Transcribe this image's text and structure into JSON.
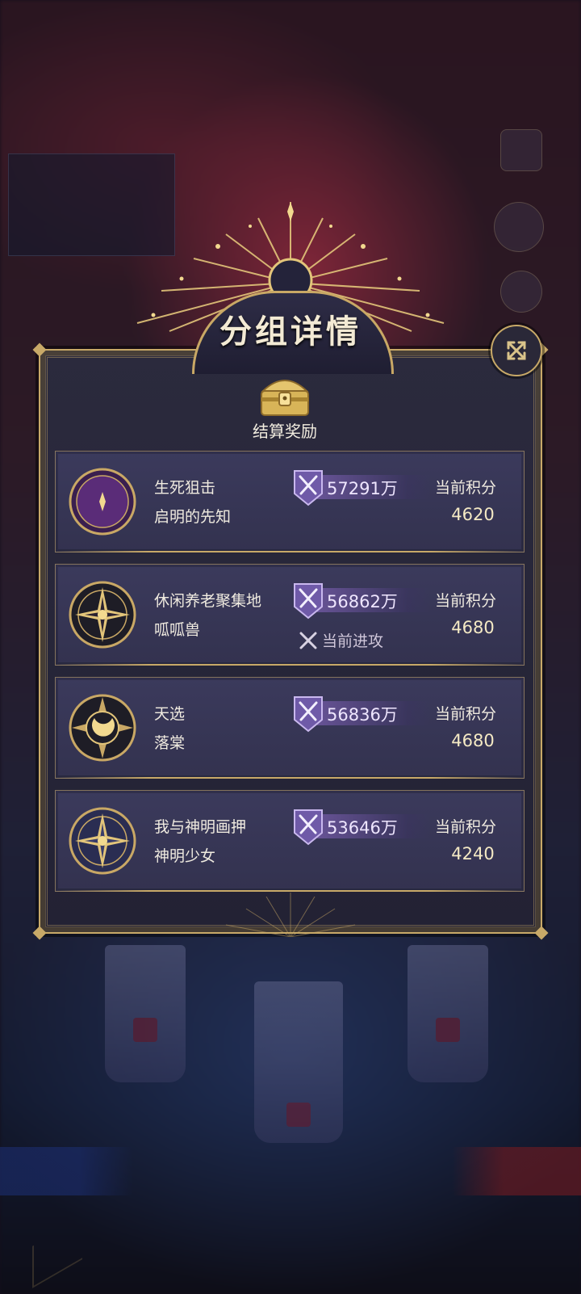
{
  "modal": {
    "title": "分组详情",
    "reward_label": "结算奖励"
  },
  "rows": [
    {
      "guild": "生死狙击",
      "leader": "启明的先知",
      "power": "57291万",
      "score_label": "当前积分",
      "score": "4620",
      "emblem": "crescent-moon-emblem",
      "status": ""
    },
    {
      "guild": "休闲养老聚集地",
      "leader": "呱呱兽",
      "power": "56862万",
      "score_label": "当前积分",
      "score": "4680",
      "emblem": "compass-star-emblem",
      "status": "当前进攻"
    },
    {
      "guild": "天选",
      "leader": "落棠",
      "power": "56836万",
      "score_label": "当前积分",
      "score": "4680",
      "emblem": "sun-moon-emblem",
      "status": ""
    },
    {
      "guild": "我与神明画押",
      "leader": "神明少女",
      "power": "53646万",
      "score_label": "当前积分",
      "score": "4240",
      "emblem": "compass-star-emblem",
      "status": ""
    }
  ],
  "colors": {
    "gold": "#c8a968",
    "panel": "#2b2a3d",
    "row": "#3b3a5c",
    "power_bar": "#765caa"
  },
  "icons": [
    "close-icon",
    "treasure-chest-icon",
    "crossed-swords-shield-icon",
    "crossed-swords-icon"
  ]
}
